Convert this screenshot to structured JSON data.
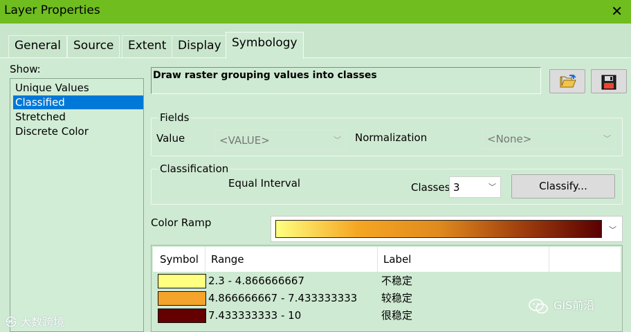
{
  "window": {
    "title": "Layer Properties"
  },
  "tabs": [
    {
      "label": "General"
    },
    {
      "label": "Source"
    },
    {
      "label": "Extent"
    },
    {
      "label": "Display"
    },
    {
      "label": "Symbology",
      "active": true
    }
  ],
  "show": {
    "label": "Show:",
    "items": [
      {
        "label": "Unique Values"
      },
      {
        "label": "Classified",
        "selected": true
      },
      {
        "label": "Stretched"
      },
      {
        "label": "Discrete Color"
      }
    ]
  },
  "description": "Draw raster grouping values into classes",
  "fields": {
    "title": "Fields",
    "value_label": "Value",
    "value_selected": "<VALUE>",
    "normalization_label": "Normalization",
    "normalization_selected": "<None>"
  },
  "classification": {
    "title": "Classification",
    "method": "Equal Interval",
    "classes_label": "Classes",
    "classes_value": "3",
    "classify_button": "Classify..."
  },
  "color_ramp": {
    "label": "Color Ramp",
    "stops": [
      "#ffff80",
      "#f5a623",
      "#e08a1e",
      "#a0400e",
      "#5a0000"
    ]
  },
  "symbol_table": {
    "headers": [
      "Symbol",
      "Range",
      "Label"
    ],
    "rows": [
      {
        "color": "#ffff80",
        "range": "2.3 - 4.866666667",
        "label": "不稳定"
      },
      {
        "color": "#f4a42b",
        "range": "4.866666667 - 7.433333333",
        "label": "较稳定"
      },
      {
        "color": "#640000",
        "range": "7.433333333 - 10",
        "label": "很稳定"
      }
    ]
  },
  "watermarks": {
    "left": "大数跨境",
    "right": "GIS前沿"
  },
  "icons": [
    "close-icon",
    "open-folder-icon",
    "save-disk-icon",
    "chevron-down-icon",
    "wechat-icon"
  ]
}
